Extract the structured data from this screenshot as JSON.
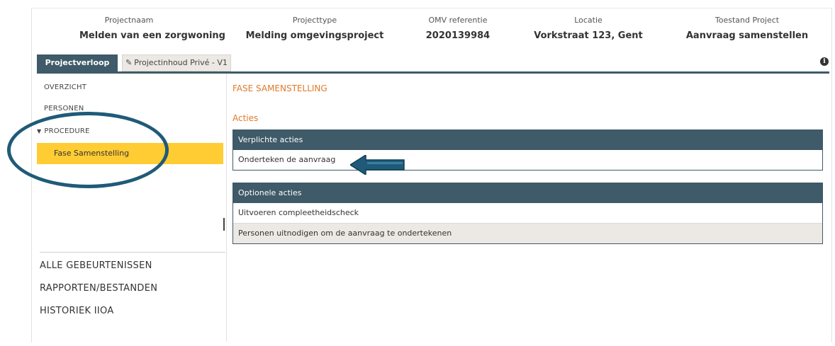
{
  "project_summary": [
    {
      "label": "Projectnaam",
      "value": "Melden van een zorgwoning"
    },
    {
      "label": "Projecttype",
      "value": "Melding omgevingsproject"
    },
    {
      "label": "OMV referentie",
      "value": "2020139984"
    },
    {
      "label": "Locatie",
      "value": "Vorkstraat 123, Gent"
    },
    {
      "label": "Toestand Project",
      "value": "Aanvraag samenstellen"
    }
  ],
  "tabs": {
    "active": "Projectverloop",
    "inactive": "Projectinhoud Privé - V1"
  },
  "icons": {
    "pencil": "pencil-icon",
    "info": "info-icon",
    "expand": "triangle-down-icon"
  },
  "sidebar": {
    "items": [
      "OVERZICHT",
      "PERSONEN",
      "PROCEDURE"
    ],
    "selected_sub": "Fase Samenstelling",
    "bottom_links": [
      "ALLE GEBEURTENISSEN",
      "RAPPORTEN/BESTANDEN",
      "HISTORIEK IIOA"
    ]
  },
  "main": {
    "phase_title": "FASE SAMENSTELLING",
    "actions_title": "Acties",
    "mandatory": {
      "header": "Verplichte acties",
      "rows": [
        "Onderteken de aanvraag"
      ]
    },
    "optional": {
      "header": "Optionele acties",
      "rows": [
        "Uitvoeren compleetheidscheck",
        "Personen uitnodigen om de aanvraag te ondertekenen"
      ]
    }
  },
  "colors": {
    "header_bar": "#3f5a68",
    "accent_orange": "#e07a2a",
    "highlight_yellow": "#ffcc33",
    "annotation_blue": "#1f5b78"
  }
}
